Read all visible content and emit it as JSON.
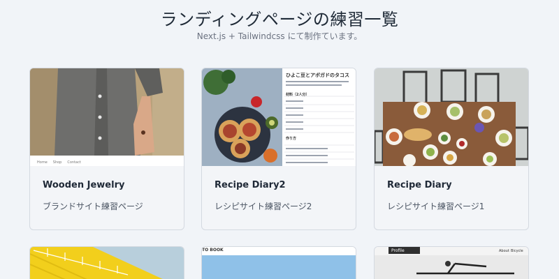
{
  "header": {
    "title": "ランディングページの練習一覧",
    "subtitle": "Next.js + Tailwindcss にて制作ています。"
  },
  "cards": [
    {
      "title": "Wooden Jewelry",
      "description": "ブランドサイト練習ページ",
      "thumb_nav": [
        "Home",
        "Shop",
        "Contact"
      ]
    },
    {
      "title": "Recipe Diary2",
      "description": "レシピサイト練習ページ2",
      "thumb_heading": "ひよこ豆とアボガドのタコス",
      "thumb_section1": "材料（2人分）",
      "thumb_section2": "作り方"
    },
    {
      "title": "Recipe Diary",
      "description": "レシピサイト練習ページ1"
    }
  ],
  "bottom_cards": [
    {
      "thumb_label": ""
    },
    {
      "thumb_label": "TO BOOK"
    },
    {
      "thumb_label": "Profile",
      "thumb_links": [
        "About",
        "Bicycle"
      ]
    }
  ],
  "colors": {
    "background": "#f1f4f8",
    "card_border": "#d4d9e0"
  }
}
